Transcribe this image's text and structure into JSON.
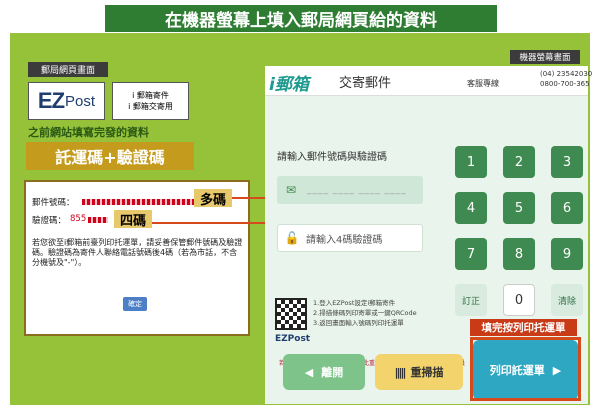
{
  "banner": "在機器螢幕上填入郵局網頁給的資料",
  "left": {
    "section_label": "郵局網頁畫面",
    "logo_text_ez": "EZ",
    "logo_text_post": "Post",
    "menu_line1": "i 郵箱寄件",
    "menu_line2": "i 郵箱交寄用",
    "caption": "之前網站填寫完發的資料",
    "badge": "託運碼+驗證碼",
    "mail_code_label": "郵件號碼：",
    "verify_code_label": "驗證碼：",
    "verify_code_prefix": "855",
    "notice": "若您欲至i郵箱前臺列印托運單，請妥善保管郵件號碼及驗證碼。驗證碼為寄件人聯絡電話號碼後4碼（若為市話，不含分機號及\"-\"）。",
    "ok_button": "確定"
  },
  "callouts": {
    "multi": "多碼",
    "four": "四碼",
    "print_hint": "填完按列印托運單"
  },
  "kiosk": {
    "section_label": "機器螢幕畫面",
    "logo": "i郵箱",
    "title": "交寄郵件",
    "service": "客服專線",
    "phone1": "(04) 23542030",
    "phone2": "0800-700-365",
    "prompt_mail": "請輸入郵件號碼與驗證碼",
    "placeholder_mail": "",
    "prompt_verify": "請輸入4碼驗證碼",
    "keys": [
      "1",
      "2",
      "3",
      "4",
      "5",
      "6",
      "7",
      "8",
      "9"
    ],
    "key_correct": "訂正",
    "key_zero": "0",
    "key_clear": "清除",
    "steps": [
      "1.登入EZPost設定i郵箱寄件",
      "2.掃描條碼列印寄單或一鍵QRCode",
      "3.返回畫面輸入號碼列印托運單"
    ],
    "ez_small": "EZPost",
    "footnote": "若資料有誤或驗證碼錯誤，請按此重新填寫相關資訊，或請洽服務人員",
    "btn_leave": "離開",
    "btn_rescan": "重掃描",
    "btn_print": "列印託運單"
  }
}
